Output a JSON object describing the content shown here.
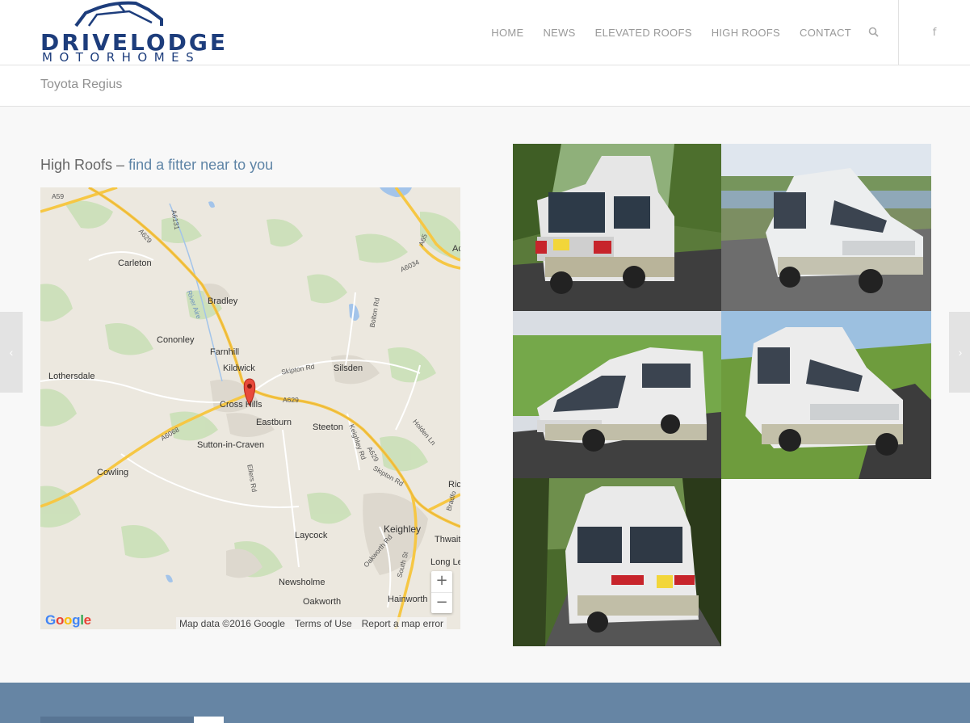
{
  "brand": {
    "name_top": "DRIVELODGE",
    "name_bottom": "MOTORHOMES",
    "color": "#1d3d7c"
  },
  "nav": {
    "items": [
      {
        "label": "HOME"
      },
      {
        "label": "NEWS"
      },
      {
        "label": "ELEVATED ROOFS"
      },
      {
        "label": "HIGH ROOFS"
      },
      {
        "label": "CONTACT"
      }
    ],
    "search_icon": "search-icon",
    "social_icon": "facebook-icon",
    "social_glyph": "f"
  },
  "page": {
    "title": "Toyota Regius"
  },
  "content": {
    "heading_prefix": "High Roofs – ",
    "heading_link": "find a fitter near to you",
    "link_color": "#5e84a6"
  },
  "map": {
    "towns": [
      {
        "name": "Carleton"
      },
      {
        "name": "Bradley"
      },
      {
        "name": "Cononley"
      },
      {
        "name": "Farnhill"
      },
      {
        "name": "Kildwick"
      },
      {
        "name": "Silsden"
      },
      {
        "name": "Lothersdale"
      },
      {
        "name": "Cross Hills"
      },
      {
        "name": "Eastburn"
      },
      {
        "name": "Steeton"
      },
      {
        "name": "Sutton-in-Craven"
      },
      {
        "name": "Cowling"
      },
      {
        "name": "Laycock"
      },
      {
        "name": "Keighley"
      },
      {
        "name": "Newsholme"
      },
      {
        "name": "Oakworth"
      },
      {
        "name": "Hainworth"
      },
      {
        "name": "Thwait"
      },
      {
        "name": "Long Le"
      },
      {
        "name": "Ric"
      },
      {
        "name": "Ac"
      }
    ],
    "roads": [
      {
        "name": "A59"
      },
      {
        "name": "A629"
      },
      {
        "name": "A6131"
      },
      {
        "name": "A65"
      },
      {
        "name": "A6034"
      },
      {
        "name": "River Aire"
      },
      {
        "name": "Bolton Rd"
      },
      {
        "name": "Skipton Rd"
      },
      {
        "name": "A629"
      },
      {
        "name": "A6068"
      },
      {
        "name": "Holden Ln"
      },
      {
        "name": "Keighley Rd"
      },
      {
        "name": "A629"
      },
      {
        "name": "Skipton Rd"
      },
      {
        "name": "Ellers Rd"
      },
      {
        "name": "Oakworth Rd"
      },
      {
        "name": "South St"
      },
      {
        "name": "Bradfo"
      }
    ],
    "zoom_in": "+",
    "zoom_out": "−",
    "google_logo": "Google",
    "footer": {
      "data": "Map data ©2016 Google",
      "terms": "Terms of Use",
      "report": "Report a map error"
    },
    "marker_color": "#e84a3c"
  },
  "gallery": {
    "images": [
      {
        "plate": "R975 CAK",
        "icon": "photo-van-rear-trees"
      },
      {
        "plate": "R975 CAK",
        "icon": "photo-van-front-lake"
      },
      {
        "plate": "",
        "icon": "photo-van-side-fields"
      },
      {
        "plate": "R975 CAK",
        "icon": "photo-van-front-road"
      },
      {
        "plate": "R975 CAK",
        "icon": "photo-van-rear-lane"
      }
    ]
  },
  "side_nav": {
    "prev_glyph": "‹",
    "next_glyph": "›"
  }
}
